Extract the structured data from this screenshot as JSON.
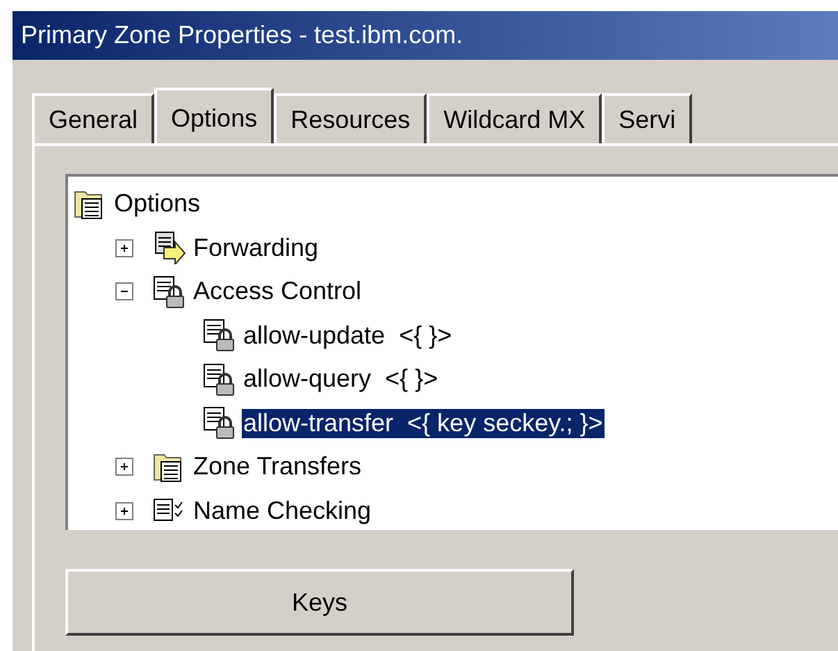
{
  "window": {
    "title": "Primary Zone Properties - test.ibm.com."
  },
  "tabs": [
    {
      "label": "General",
      "selected": false
    },
    {
      "label": "Options",
      "selected": true
    },
    {
      "label": "Resources",
      "selected": false
    },
    {
      "label": "Wildcard MX",
      "selected": false
    },
    {
      "label": "Servi",
      "selected": false
    }
  ],
  "tree": [
    {
      "label": "Options",
      "kind": "folder",
      "selected": false,
      "children": [
        {
          "label": "Forwarding",
          "kind": "forward",
          "expanded": false,
          "selected": false
        },
        {
          "label": "Access Control",
          "kind": "lock",
          "expanded": true,
          "selected": false,
          "children": [
            {
              "label": "allow-update  <{ }>",
              "kind": "lock",
              "selected": false
            },
            {
              "label": "allow-query  <{ }>",
              "kind": "lock",
              "selected": false
            },
            {
              "label": "allow-transfer  <{ key seckey.; }>",
              "kind": "lock",
              "selected": true
            }
          ]
        },
        {
          "label": "Zone Transfers",
          "kind": "folder",
          "expanded": false,
          "selected": false
        },
        {
          "label": "Name Checking",
          "kind": "check",
          "expanded": false,
          "selected": false
        }
      ]
    }
  ],
  "buttons": [
    {
      "label": "Keys"
    }
  ]
}
